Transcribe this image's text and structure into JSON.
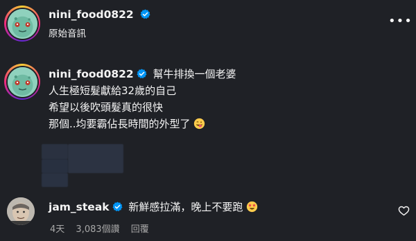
{
  "post": {
    "username": "nini_food0822",
    "subtitle": "原始音訊",
    "more_glyph": "•••",
    "avatar_icon": "bulbasaur-avatar-icon"
  },
  "caption": {
    "username": "nini_food0822",
    "lines": [
      "幫牛排換一個老婆",
      "人生極短髮獻給32歲的自己",
      "希望以後吹頭髮真的很快",
      "那個..均要霸佔長時間的外型了"
    ],
    "emoji_icon": "face-savoring-food-emoji"
  },
  "comment": {
    "username": "jam_steak",
    "text": "新鮮感拉滿，晚上不要跑",
    "emoji_icon": "star-struck-emoji",
    "time_ago": "4天",
    "likes": "3,083個讚",
    "reply_label": "回覆",
    "like_icon": "heart-outline-icon"
  },
  "colors": {
    "background": "#1f2126",
    "verified_blue": "#0095f6",
    "meta_gray": "#a8a8a8"
  }
}
